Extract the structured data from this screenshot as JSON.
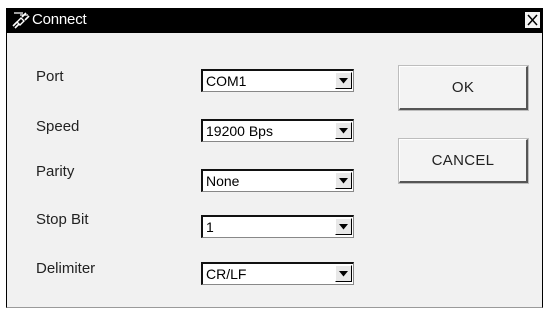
{
  "window": {
    "title": "Connect",
    "icon": "connect-plug-icon",
    "close_icon": "close-icon"
  },
  "fields": {
    "port": {
      "label": "Port",
      "value": "COM1"
    },
    "speed": {
      "label": "Speed",
      "value": "19200 Bps"
    },
    "parity": {
      "label": "Parity",
      "value": "None"
    },
    "stop_bit": {
      "label": "Stop Bit",
      "value": "1"
    },
    "delimiter": {
      "label": "Delimiter",
      "value": "CR/LF"
    }
  },
  "buttons": {
    "ok": "OK",
    "cancel": "CANCEL"
  }
}
